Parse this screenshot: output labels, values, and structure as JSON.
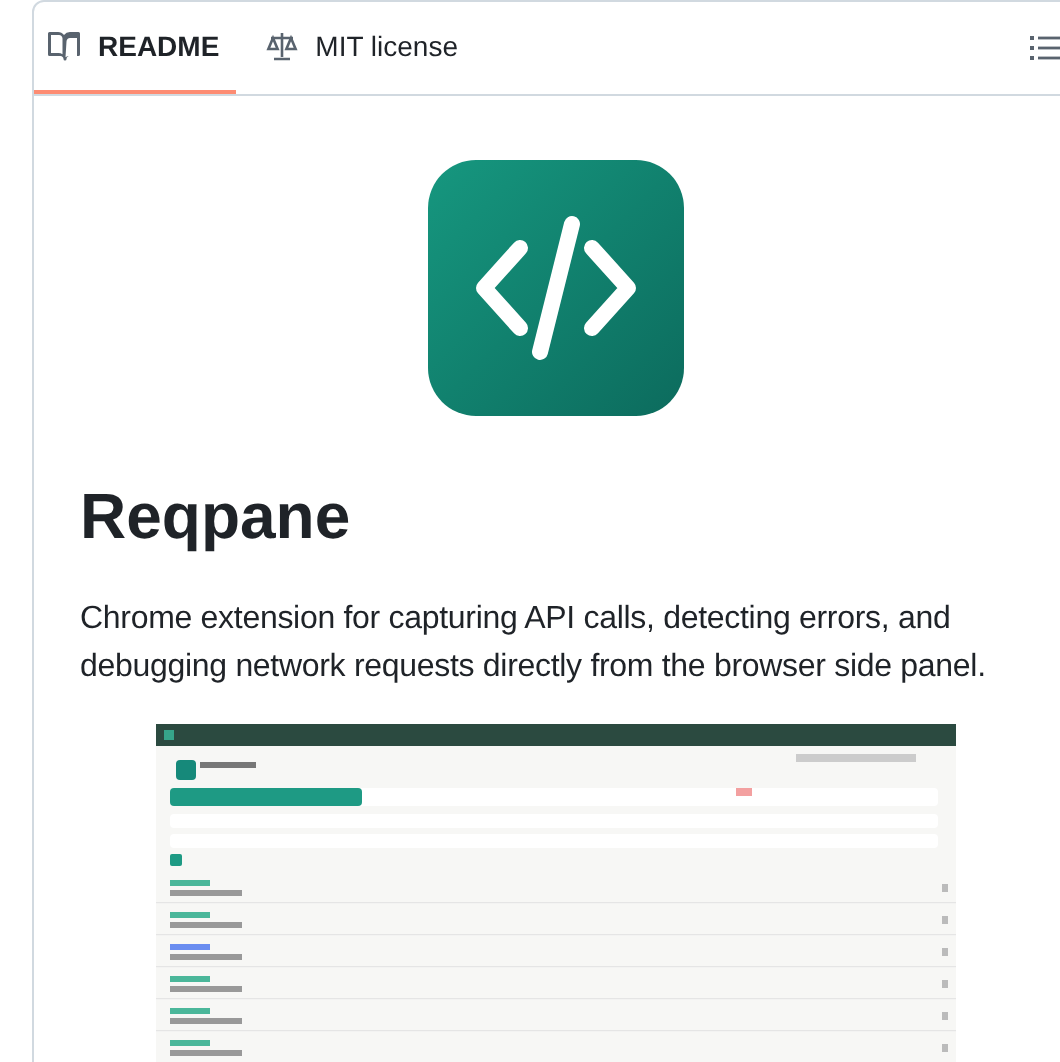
{
  "tabs": [
    {
      "label": "README",
      "selected": true
    },
    {
      "label": "MIT license",
      "selected": false
    }
  ],
  "readme": {
    "title": "Reqpane",
    "description": "Chrome extension for capturing API calls, detecting errors, and debugging network requests directly from the browser side panel."
  }
}
